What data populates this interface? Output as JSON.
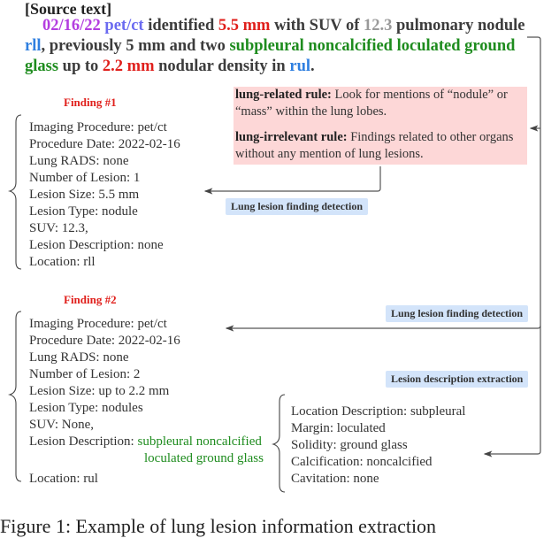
{
  "source": {
    "title": "[Source text]",
    "segments": [
      {
        "text": "02/16/22",
        "role": "date"
      },
      {
        "text": " ",
        "role": "plain"
      },
      {
        "text": "pet/ct",
        "role": "procedure"
      },
      {
        "text": " identified ",
        "role": "plain"
      },
      {
        "text": "5.5 mm",
        "role": "size"
      },
      {
        "text": " with SUV of ",
        "role": "plain"
      },
      {
        "text": "12.3",
        "role": "suv"
      },
      {
        "text": " pulmonary nodule ",
        "role": "plain"
      },
      {
        "text": "rll",
        "role": "location"
      },
      {
        "text": ", previously 5 mm and two ",
        "role": "plain"
      },
      {
        "text": "subpleural noncalcified loculated ground glass",
        "role": "description"
      },
      {
        "text": " up to ",
        "role": "plain"
      },
      {
        "text": "2.2 mm",
        "role": "size"
      },
      {
        "text": " nodular density in ",
        "role": "plain"
      },
      {
        "text": "rul",
        "role": "location"
      },
      {
        "text": ".",
        "role": "plain"
      }
    ],
    "colors": {
      "date": "#b43ee0",
      "procedure": "#6a6af0",
      "size": "#e0201c",
      "suv": "#9a9a9a",
      "location": "#2f7fe0",
      "description": "#1e8c1e"
    }
  },
  "rules": {
    "related_label": "lung-related rule:",
    "related_text": " Look for mentions of “nodule” or “mass” within the lung lobes.",
    "irrelevant_label": "lung-irrelevant rule:",
    "irrelevant_text": " Findings related to other organs without any mention of lung lesions."
  },
  "tags": {
    "detection_1": "Lung lesion finding detection",
    "detection_2": "Lung lesion finding detection",
    "extraction": "Lesion description extraction"
  },
  "finding1": {
    "title": "Finding #1",
    "fields": [
      "Imaging Procedure: pet/ct",
      "Procedure Date: 2022-02-16",
      "Lung RADS: none",
      "Number of Lesion: 1",
      "Lesion Size: 5.5 mm",
      "Lesion Type: nodule",
      "SUV: 12.3,",
      "Lesion Description: none",
      "Location: rll"
    ]
  },
  "finding2": {
    "title": "Finding #2",
    "fields": [
      "Imaging Procedure: pet/ct",
      "Procedure Date: 2022-02-16",
      "Lung RADS: none",
      "Number of Lesion: 2",
      "Lesion Size: up to 2.2 mm",
      "Lesion Type: nodules",
      "SUV: None,"
    ],
    "desc_label": "Lesion Description: ",
    "desc_line1": "subpleural noncalcified",
    "desc_line2": "loculated ground glass",
    "location": "Location: rul"
  },
  "description": {
    "fields": [
      "Location Description: subpleural",
      "Margin: loculated",
      "Solidity: ground glass",
      "Calcification: noncalcified",
      "Cavitation: none"
    ]
  },
  "caption": "Figure 1: Example of lung lesion information extraction"
}
